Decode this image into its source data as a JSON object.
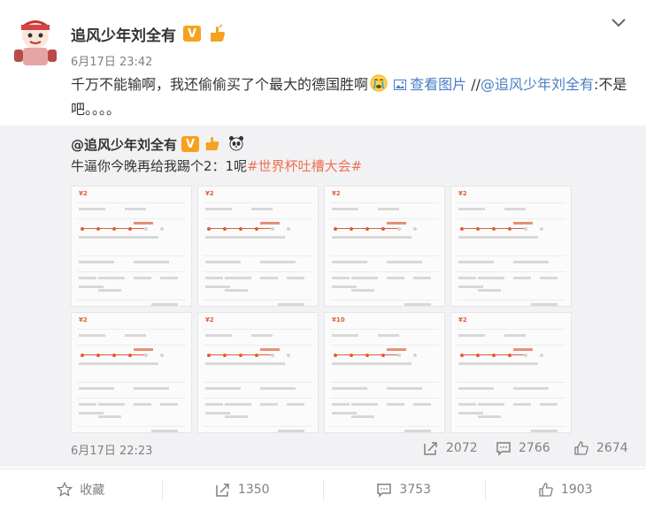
{
  "post": {
    "author": "追风少年刘全有",
    "time": "6月17日 23:42",
    "text_main": "千万不能输啊，我还偷偷买了个最大的德国胜啊",
    "view_pic_label": "查看图片",
    "repost_sep": " //",
    "mention": "@追风少年刘全有",
    "text_tail": ":不是吧。。。。"
  },
  "repost": {
    "author": "@追风少年刘全有",
    "text_main": "牛逼你今晚再给我踢个2：1呢",
    "hashtag": "#世界杯吐槽大会#",
    "time": "6月17日 22:23",
    "stats": {
      "forward": "2072",
      "comment": "2766",
      "like": "2674"
    },
    "thumbs": [
      {
        "amount": "¥2"
      },
      {
        "amount": "¥2"
      },
      {
        "amount": "¥2"
      },
      {
        "amount": "¥2"
      },
      {
        "amount": "¥2"
      },
      {
        "amount": "¥2"
      },
      {
        "amount": "¥10"
      },
      {
        "amount": "¥2"
      }
    ]
  },
  "actions": {
    "favorite": "收藏",
    "forward": "1350",
    "comment": "3753",
    "like": "1903"
  },
  "colors": {
    "accent": "#eb7350",
    "link": "#4a7ec4",
    "muted": "#808080",
    "repost_bg": "#f2f2f5"
  }
}
